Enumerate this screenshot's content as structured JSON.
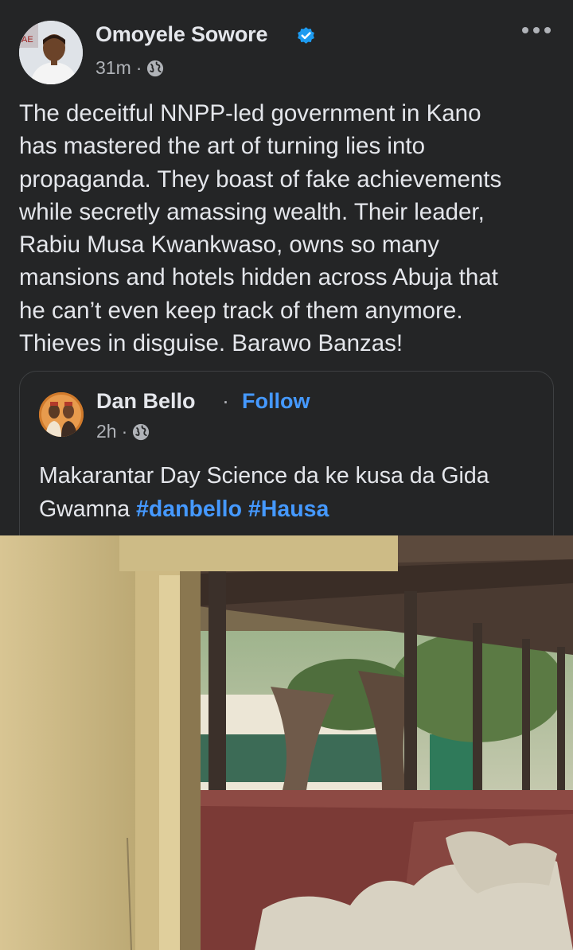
{
  "post": {
    "author": "Omoyele Sowore",
    "timestamp": "31m",
    "meta_separator": "·",
    "body": "The deceitful NNPP-led government in Kano\nhas mastered the art of turning lies into\npropaganda. They boast of fake achievements\nwhile secretly amassing wealth. Their leader,\nRabiu Musa Kwankwaso, owns so many\nmansions and hotels hidden across Abuja that\nhe can’t even keep track of them anymore.\nThieves in disguise.  Barawo Banzas!",
    "icons": {
      "verified": "verified-badge-icon",
      "audience": "globe-icon",
      "more": "more-options-icon"
    },
    "colors": {
      "verified": "#1d9bf0"
    }
  },
  "shared": {
    "author": "Dan Bello",
    "separator": "·",
    "follow_label": "Follow",
    "timestamp": "2h",
    "meta_separator": "·",
    "text": "Makarantar Day Science da ke kusa da Gida Gwamna",
    "hashtags": [
      "#danbello",
      "#Hausa"
    ]
  },
  "colors": {
    "background": "#242526",
    "text": "#e4e6eb",
    "secondary": "#b0b3b8",
    "link": "#4599ff",
    "card_border": "#3e4042"
  }
}
